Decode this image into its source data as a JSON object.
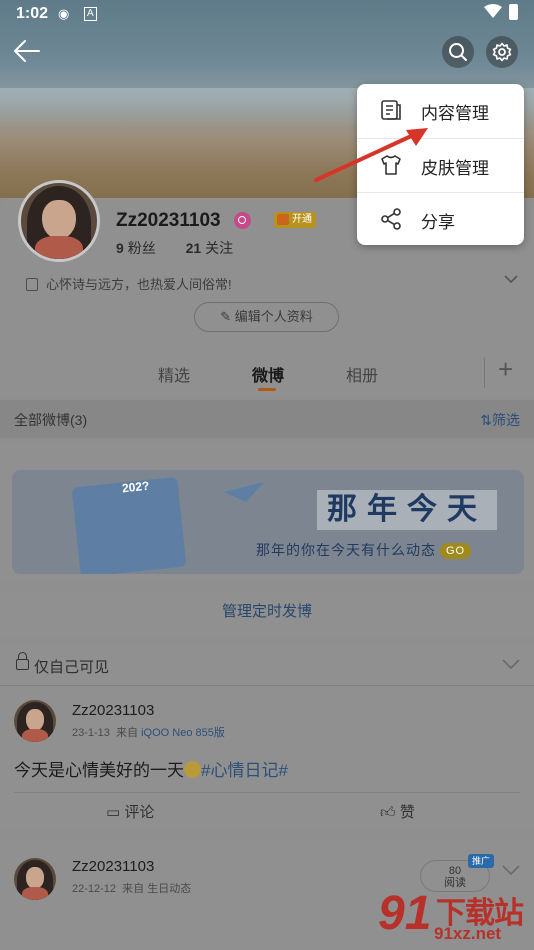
{
  "status_bar": {
    "time": "1:02",
    "icons": [
      "weibo-icon",
      "a-icon",
      "wifi-icon",
      "battery-icon"
    ]
  },
  "header": {
    "back": "back-arrow-icon",
    "search": "search-icon",
    "settings": "gear-icon"
  },
  "profile": {
    "username": "Zz20231103",
    "vip_label": "开通",
    "followers_count": "9",
    "followers_label": "粉丝",
    "following_count": "21",
    "following_label": "关注",
    "bio": "心怀诗与远方，也热爱人间俗常!",
    "edit_label": "编辑个人资料"
  },
  "tabs": [
    {
      "label": "精选",
      "active": false
    },
    {
      "label": "微博",
      "active": true
    },
    {
      "label": "相册",
      "active": false
    }
  ],
  "filter": {
    "left": "全部微博(3)",
    "right": "筛选"
  },
  "banner": {
    "calendar_year": "202?",
    "title": "那年今天",
    "subtitle": "那年的你在今天有什么动态",
    "go": "GO"
  },
  "schedule_label": "管理定时发博",
  "private_section": {
    "label": "仅自己可见"
  },
  "posts": [
    {
      "name": "Zz20231103",
      "date": "23-1-13",
      "source_prefix": "来自",
      "source": "iQOO Neo 855版",
      "text": "今天是心情美好的一天",
      "topic": "#心情日记#",
      "comment_label": "评论",
      "like_label": "赞"
    },
    {
      "name": "Zz20231103",
      "date": "22-12-12",
      "source_prefix": "来自",
      "source": "生日动态",
      "read_count": "80",
      "read_label": "阅读",
      "promo_label": "推广"
    }
  ],
  "menu": {
    "items": [
      {
        "label": "内容管理",
        "icon": "document-icon"
      },
      {
        "label": "皮肤管理",
        "icon": "tshirt-icon"
      },
      {
        "label": "分享",
        "icon": "share-icon"
      }
    ]
  },
  "watermark": {
    "logo": "91",
    "text": "下载站",
    "url": "91xz.net"
  },
  "colors": {
    "accent": "#b35a10",
    "link": "#2d4f7a",
    "watermark": "#b7312a",
    "overlay": "#8f8f8f"
  }
}
